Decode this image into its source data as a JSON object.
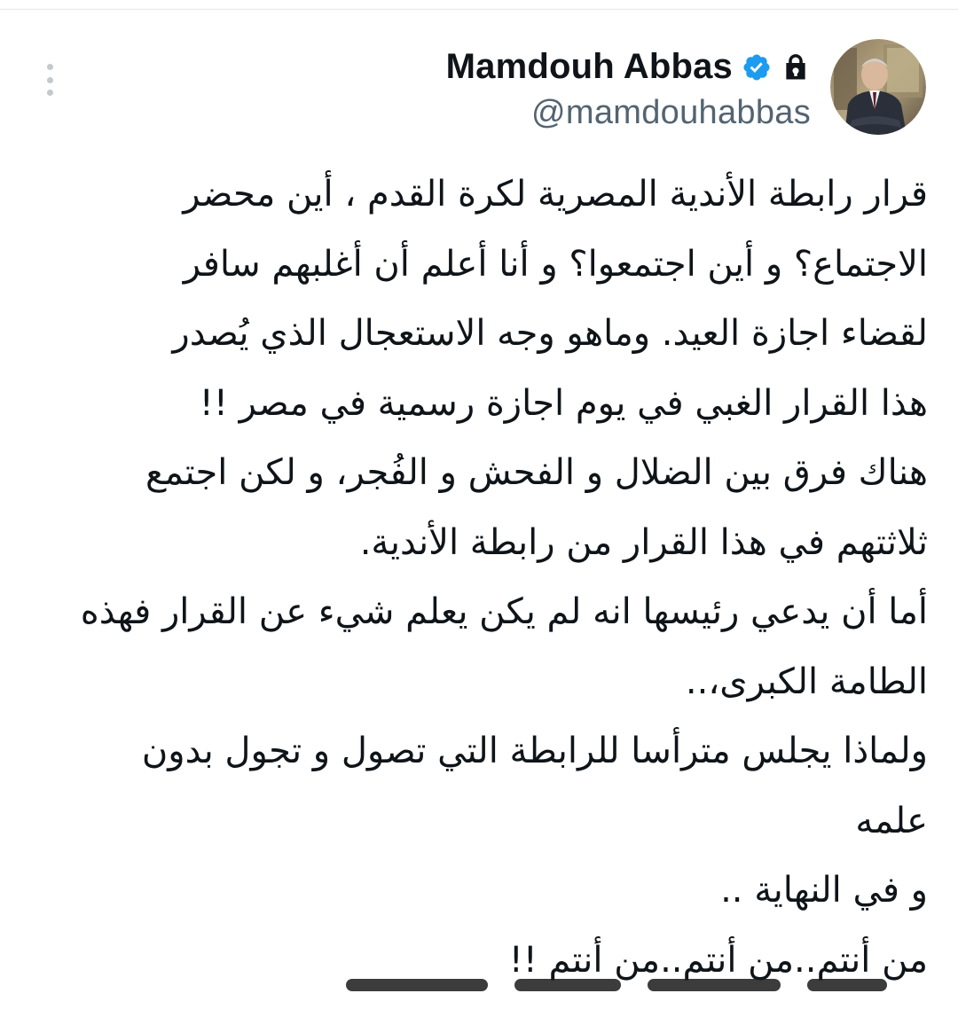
{
  "tweet": {
    "author": {
      "display_name": "Mamdouh Abbas",
      "handle": "@mamdouhabbas",
      "verified_icon": "verified-badge-icon",
      "protected_icon": "lock-icon",
      "avatar": "profile-photo"
    },
    "more_icon": "more-vertical-icon",
    "lines": [
      "قرار رابطة الأندية المصرية لكرة القدم ، أين محضر",
      "الاجتماع؟ و أين اجتمعوا؟ و أنا أعلم أن أغلبهم سافر",
      "لقضاء اجازة العيد. وماهو وجه الاستعجال الذي يُصدر",
      "هذا القرار الغبي في يوم اجازة رسمية في مصر !!",
      "هناك فرق بين الضلال و الفحش و الفُجر، و لكن اجتمع",
      "ثلاثتهم في هذا القرار من رابطة الأندية.",
      "أما أن يدعي رئيسها انه لم يكن يعلم شيء عن القرار فهذه",
      "الطامة الكبرى،..",
      "ولماذا يجلس مترأسا للرابطة التي تصول و تجول بدون",
      "علمه",
      "و في النهاية ..",
      "من أنتم..من أنتم..من أنتم !!"
    ]
  },
  "colors": {
    "text_primary": "#0f1419",
    "text_secondary": "#536471",
    "verified_blue": "#1d9bf0",
    "divider": "#e6e6e6"
  }
}
